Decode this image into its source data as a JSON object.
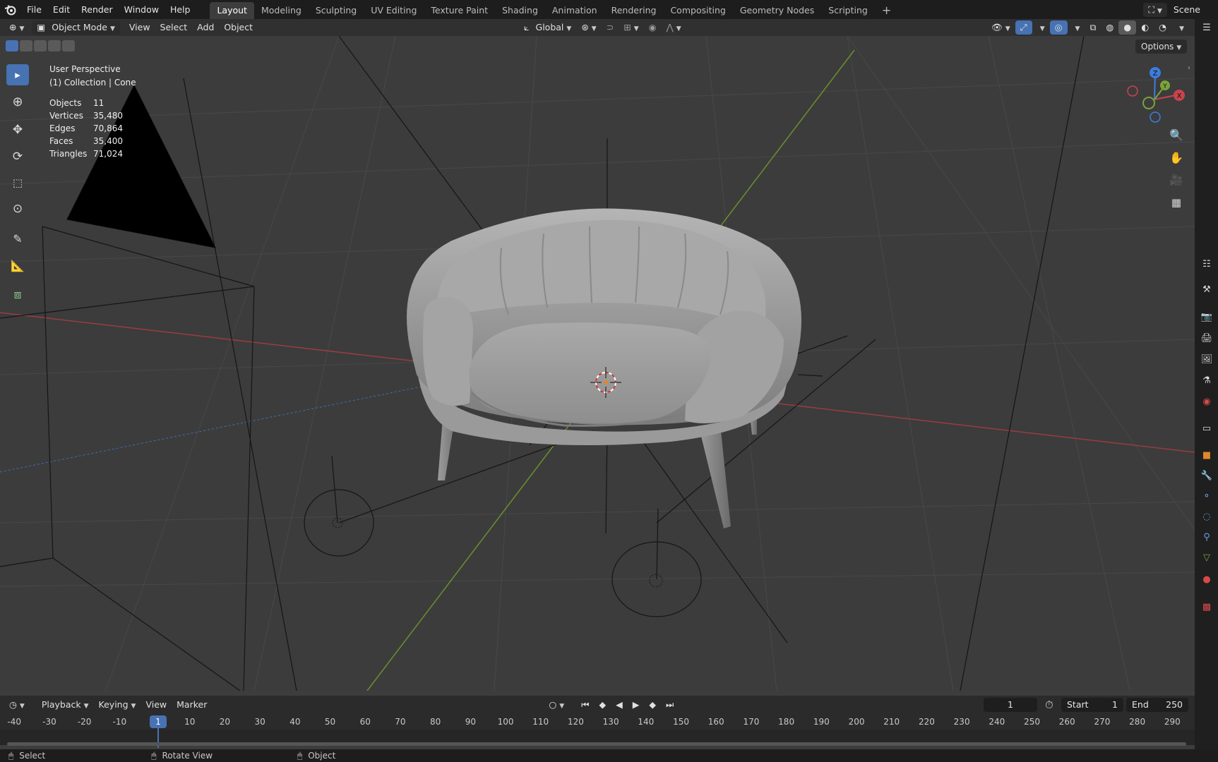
{
  "menu": {
    "items": [
      "File",
      "Edit",
      "Render",
      "Window",
      "Help"
    ]
  },
  "workspaces": {
    "tabs": [
      "Layout",
      "Modeling",
      "Sculpting",
      "UV Editing",
      "Texture Paint",
      "Shading",
      "Animation",
      "Rendering",
      "Compositing",
      "Geometry Nodes",
      "Scripting"
    ],
    "active": "Layout"
  },
  "scene": {
    "label": "Scene"
  },
  "header": {
    "mode": "Object Mode",
    "view": "View",
    "select": "Select",
    "add": "Add",
    "object": "Object",
    "orientation": "Global",
    "options": "Options"
  },
  "overlay_info": {
    "view_name": "User Perspective",
    "collection": "(1) Collection | Cone",
    "stats": [
      {
        "label": "Objects",
        "value": "11"
      },
      {
        "label": "Vertices",
        "value": "35,480"
      },
      {
        "label": "Edges",
        "value": "70,864"
      },
      {
        "label": "Faces",
        "value": "35,400"
      },
      {
        "label": "Triangles",
        "value": "71,024"
      }
    ]
  },
  "gizmo": {
    "x": "X",
    "y": "Y",
    "z": "Z"
  },
  "timeline": {
    "playback": "Playback",
    "keying": "Keying",
    "view": "View",
    "marker": "Marker",
    "current_frame": "1",
    "start_label": "Start",
    "start_value": "1",
    "end_label": "End",
    "end_value": "250",
    "ticks": [
      "-40",
      "-30",
      "-20",
      "-10",
      "1",
      "10",
      "20",
      "30",
      "40",
      "50",
      "60",
      "70",
      "80",
      "90",
      "100",
      "110",
      "120",
      "130",
      "140",
      "150",
      "160",
      "170",
      "180",
      "190",
      "200",
      "210",
      "220",
      "230",
      "240",
      "250",
      "260",
      "270",
      "280",
      "290"
    ]
  },
  "status": {
    "select": "Select",
    "rotate": "Rotate View",
    "object": "Object"
  },
  "colors": {
    "accent": "#4772b3",
    "x_axis": "#c8444d",
    "y_axis": "#7ba33a",
    "z_axis": "#3d7ddb"
  }
}
